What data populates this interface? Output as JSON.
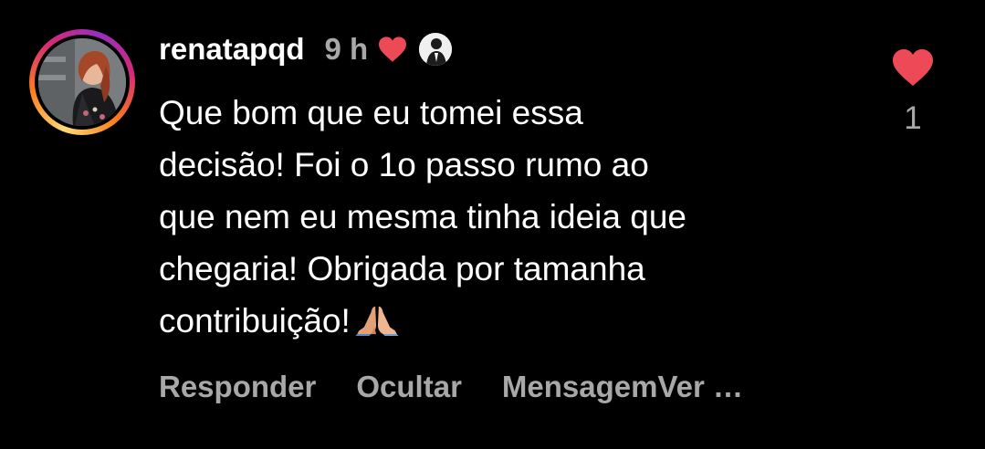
{
  "comment": {
    "username": "renatapqd",
    "time": "9 h",
    "text_lines": [
      "Que bom que eu tomei essa",
      "decisão! Foi o 1o passo rumo ao",
      "que nem eu mesma tinha ideia que",
      "chegaria! Obrigada por tamanha",
      "contribuição!"
    ],
    "emoji": "praying-hands",
    "like_count": "1",
    "colors": {
      "heart": "#ed4956",
      "secondary_text": "#a8a8a8",
      "background": "#000000"
    }
  },
  "actions": {
    "reply": "Responder",
    "hide": "Ocultar",
    "message": "Mensagem",
    "see": "Ver …"
  }
}
